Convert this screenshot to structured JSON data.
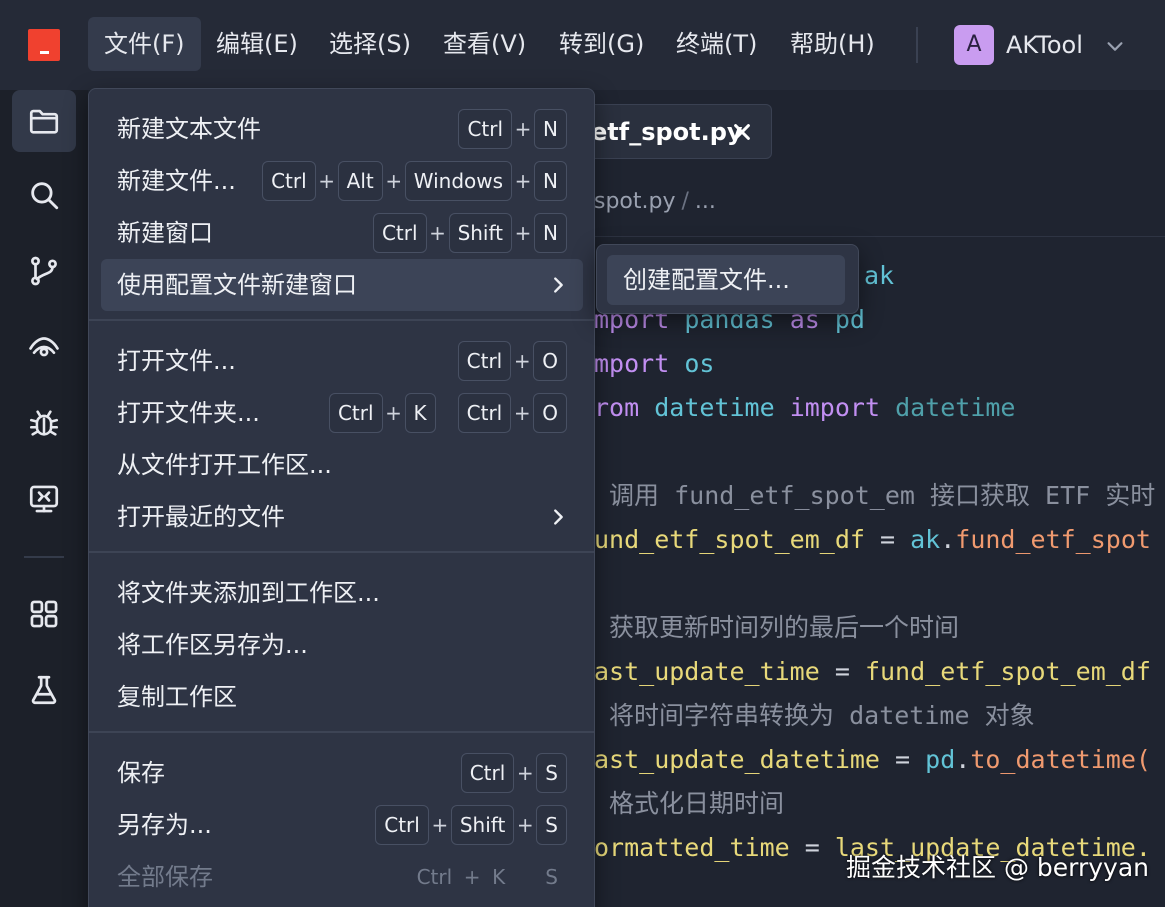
{
  "menubar": {
    "items": [
      "文件(F)",
      "编辑(E)",
      "选择(S)",
      "查看(V)",
      "转到(G)",
      "终端(T)",
      "帮助(H)"
    ],
    "account": {
      "initial": "A",
      "name": "AKTool"
    }
  },
  "activity_bar": {
    "icons": [
      "files-icon",
      "search-icon",
      "source-control-icon",
      "eye-icon",
      "debug-bug-icon",
      "remote-explorer-icon",
      "extensions-icon",
      "testing-flask-icon"
    ]
  },
  "editor": {
    "tab": {
      "label": "etf_spot.py"
    },
    "breadcrumb": {
      "file": "spot.py",
      "sep": "/",
      "more": "..."
    },
    "code_lines": [
      {
        "tokens": []
      },
      {
        "tokens": []
      },
      {
        "tokens": []
      },
      {
        "tokens": []
      }
    ]
  },
  "code": {
    "l1": {
      "a": "ak"
    },
    "l2": {
      "kw": "mport",
      "mod": "pandas",
      "as": "as",
      "alias": "pd"
    },
    "l3": {
      "kw": "mport",
      "mod": "os"
    },
    "l4": {
      "kw": "rom",
      "mod": "datetime",
      "imp": "import",
      "cls": "datetime"
    },
    "l5": {
      "cm": " 调用 fund_etf_spot_em 接口获取 ETF 实时"
    },
    "l6": {
      "var": "und_etf_spot_em_df",
      "eq": " = ",
      "mod": "ak",
      "dot": ".",
      "fn": "fund_etf_spot"
    },
    "l7": {
      "cm": " 获取更新时间列的最后一个时间"
    },
    "l8": {
      "var": "ast_update_time",
      "eq": " = ",
      "rhs": "fund_etf_spot_em_df"
    },
    "l9": {
      "cm": " 将时间字符串转换为 datetime 对象"
    },
    "l10": {
      "var": "ast_update_datetime",
      "eq": " = ",
      "mod": "pd",
      "dot": ".",
      "fn": "to_datetime("
    },
    "l11": {
      "cm": " 格式化日期时间"
    },
    "l12": {
      "var": "ormatted_time",
      "eq": " = ",
      "rhs": "last_update_datetime."
    }
  },
  "file_menu": {
    "new_text_file": {
      "label": "新建文本文件",
      "keys": [
        "Ctrl",
        "N"
      ]
    },
    "new_file": {
      "label": "新建文件...",
      "keys": [
        "Ctrl",
        "Alt",
        "Windows",
        "N"
      ]
    },
    "new_window": {
      "label": "新建窗口",
      "keys": [
        "Ctrl",
        "Shift",
        "N"
      ]
    },
    "new_window_profile": {
      "label": "使用配置文件新建窗口"
    },
    "open_file": {
      "label": "打开文件...",
      "keys": [
        "Ctrl",
        "O"
      ]
    },
    "open_folder": {
      "label": "打开文件夹...",
      "chord1": [
        "Ctrl",
        "K"
      ],
      "chord2": [
        "Ctrl",
        "O"
      ]
    },
    "open_workspace": {
      "label": "从文件打开工作区..."
    },
    "open_recent": {
      "label": "打开最近的文件"
    },
    "add_folder": {
      "label": "将文件夹添加到工作区..."
    },
    "save_workspace_as": {
      "label": "将工作区另存为..."
    },
    "duplicate_workspace": {
      "label": "复制工作区"
    },
    "save": {
      "label": "保存",
      "keys": [
        "Ctrl",
        "S"
      ]
    },
    "save_as": {
      "label": "另存为...",
      "keys": [
        "Ctrl",
        "Shift",
        "S"
      ]
    },
    "save_all": {
      "label": "全部保存",
      "chord1": [
        "Ctrl",
        "K"
      ],
      "chord2": [
        "S"
      ]
    },
    "plus": "+"
  },
  "submenu": {
    "create_profile": "创建配置文件..."
  },
  "watermark": "掘金技术社区 @ berryyan",
  "colors": {
    "logo": "#f0412f",
    "avatar": "#c99cf0",
    "keyword": "#c28ff2",
    "module": "#62c3d6",
    "variable": "#e8d97a",
    "function": "#f09a6f"
  }
}
